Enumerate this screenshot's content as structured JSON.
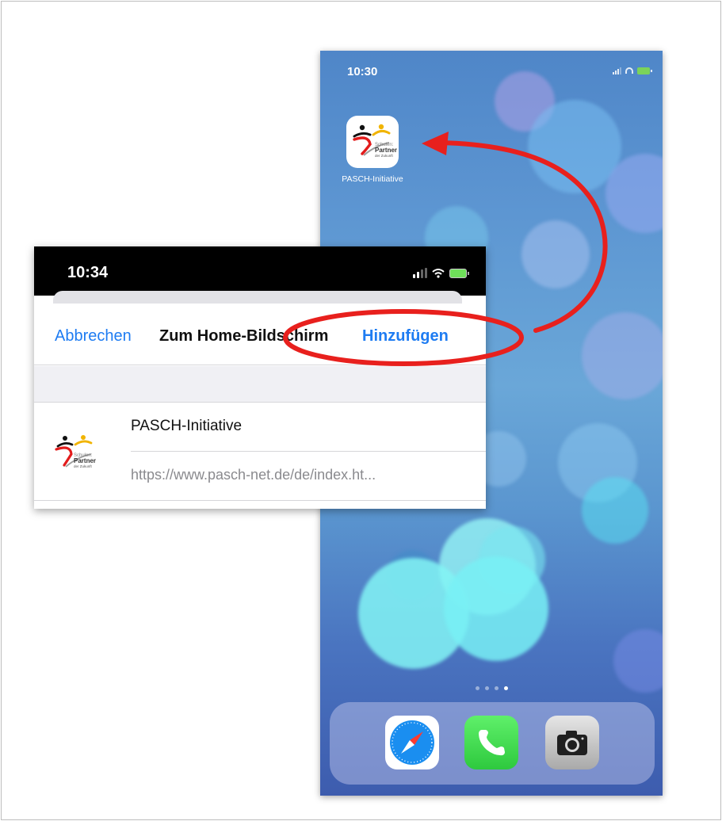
{
  "home_screen": {
    "time": "10:30",
    "app_icon": {
      "name": "PASCH-Initiative",
      "icon": "pasch-logo-icon",
      "logo_text": [
        "Schulen:",
        "Partner",
        "der Zukunft"
      ]
    },
    "page_indicator": {
      "count": 4,
      "active_index": 3
    },
    "dock_apps": [
      {
        "name": "Safari",
        "icon": "safari-icon"
      },
      {
        "name": "Phone",
        "icon": "phone-icon"
      },
      {
        "name": "Camera",
        "icon": "camera-icon"
      }
    ]
  },
  "add_sheet": {
    "time": "10:34",
    "cancel_label": "Abbrechen",
    "title": "Zum Home-Bildschirm",
    "add_label": "Hinzufügen",
    "bookmark": {
      "name": "PASCH-Initiative",
      "url": "https://www.pasch-net.de/de/index.ht..."
    }
  },
  "annotation": {
    "highlight_color": "#e8201d",
    "target": "add_label"
  }
}
